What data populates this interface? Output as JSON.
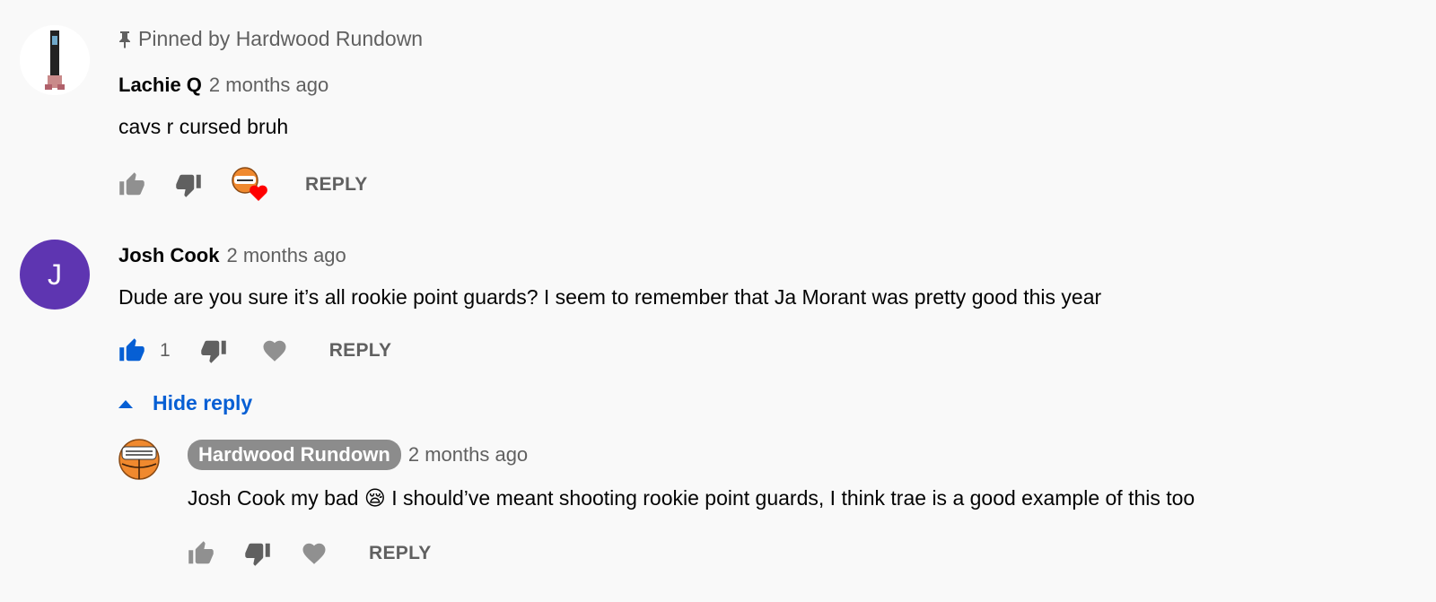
{
  "comments": [
    {
      "pinned_label": "Pinned by Hardwood Rundown",
      "author": "Lachie Q",
      "time": "2 months ago",
      "text": "cavs r cursed bruh",
      "reply_label": "REPLY"
    },
    {
      "author": "Josh Cook",
      "avatar_letter": "J",
      "time": "2 months ago",
      "text": "Dude are you sure it’s all rookie point guards? I seem to remember that Ja Morant was pretty good this year",
      "like_count": "1",
      "reply_label": "REPLY",
      "hide_reply_label": "Hide reply",
      "reply": {
        "author": "Hardwood Rundown",
        "time": "2 months ago",
        "text_before": "Josh Cook my bad",
        "emoji": "😪",
        "text_after": "I should’ve meant shooting rookie point guards, I think trae is a good example of this too",
        "reply_label": "REPLY"
      }
    }
  ],
  "colors": {
    "background": "#f9f9f9",
    "accent_blue": "#065fd4",
    "secondary_text": "#606060",
    "heart_red": "#ff0000",
    "avatar_purple": "#5e35b1",
    "basketball_orange": "#f0892e"
  },
  "icons": [
    "pin-icon",
    "like-icon",
    "dislike-icon",
    "heart-icon",
    "creator-heart-icon",
    "caret-up-icon"
  ]
}
